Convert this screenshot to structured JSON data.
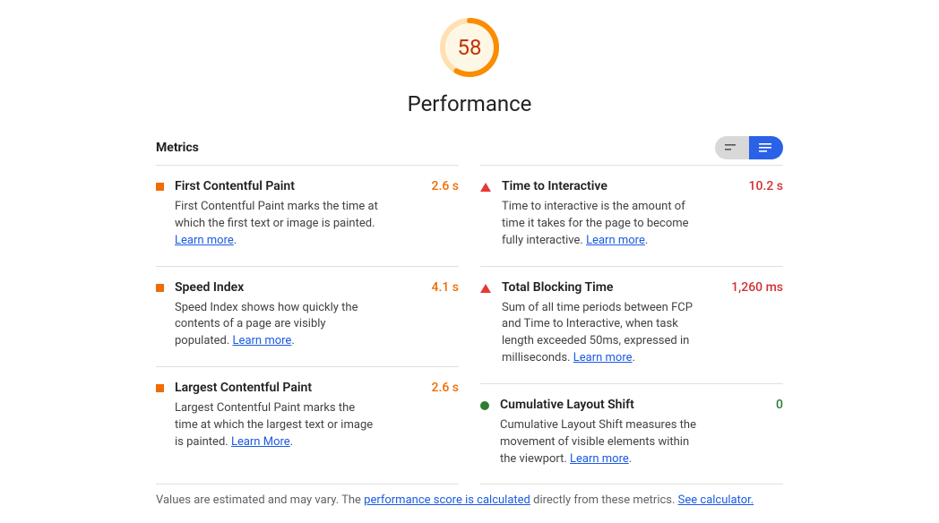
{
  "gauge": {
    "score": "58",
    "title": "Performance",
    "percent": 58
  },
  "metrics_label": "Metrics",
  "colors": {
    "orange": "#ef6c00",
    "red": "#d32f2f",
    "green": "#2e7d32",
    "link": "#1a5ae6"
  },
  "metrics": {
    "fcp": {
      "title": "First Contentful Paint",
      "value": "2.6 s",
      "desc": "First Contentful Paint marks the time at which the first text or image is painted. ",
      "learn": "Learn more"
    },
    "si": {
      "title": "Speed Index",
      "value": "4.1 s",
      "desc": "Speed Index shows how quickly the contents of a page are visibly populated. ",
      "learn": "Learn more"
    },
    "lcp": {
      "title": "Largest Contentful Paint",
      "value": "2.6 s",
      "desc": "Largest Contentful Paint marks the time at which the largest text or image is painted. ",
      "learn": "Learn More"
    },
    "tti": {
      "title": "Time to Interactive",
      "value": "10.2 s",
      "desc": "Time to interactive is the amount of time it takes for the page to become fully interactive. ",
      "learn": "Learn more"
    },
    "tbt": {
      "title": "Total Blocking Time",
      "value": "1,260 ms",
      "desc": "Sum of all time periods between FCP and Time to Interactive, when task length exceeded 50ms, expressed in milliseconds. ",
      "learn": "Learn more"
    },
    "cls": {
      "title": "Cumulative Layout Shift",
      "value": "0",
      "desc": "Cumulative Layout Shift measures the movement of visible elements within the viewport. ",
      "learn": "Learn more"
    }
  },
  "footnote": {
    "prefix": "Values are estimated and may vary. The ",
    "link1": "performance score is calculated",
    "middle": " directly from these metrics. ",
    "link2": "See calculator."
  }
}
